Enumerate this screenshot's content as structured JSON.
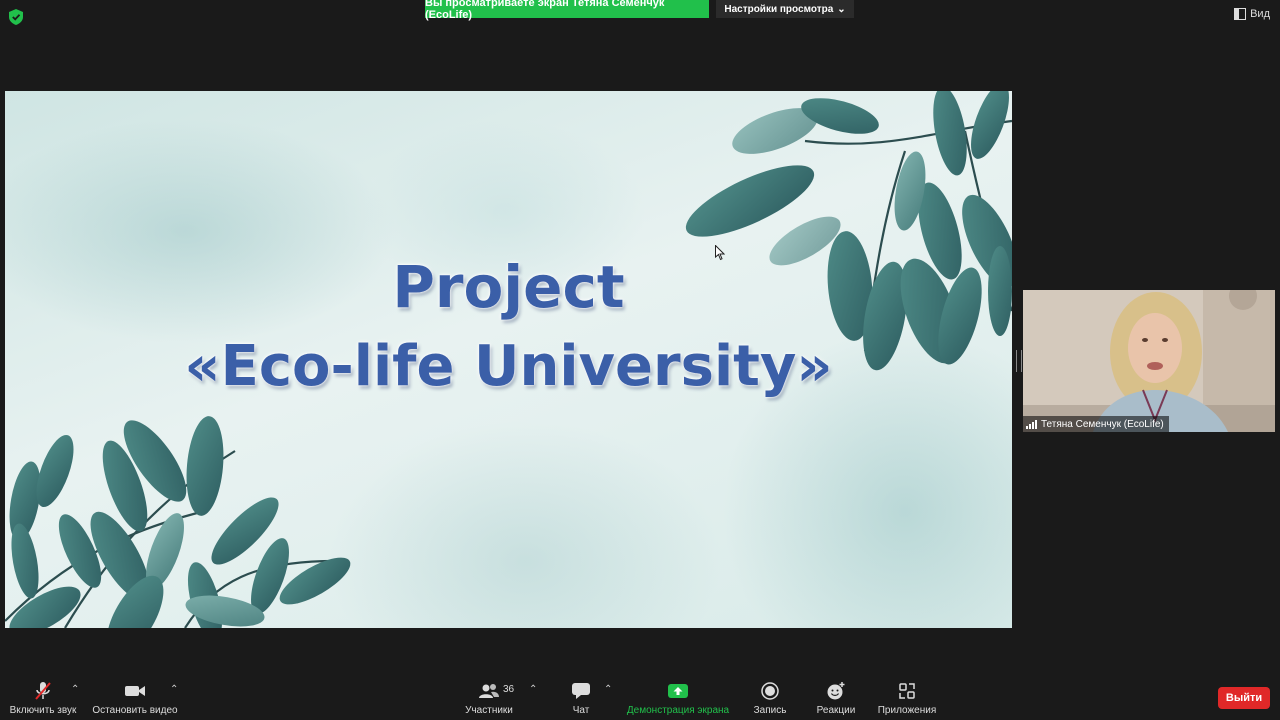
{
  "top_bar": {
    "share_banner": "Вы просматриваете экран Тетяна Семенчук (EcoLife)",
    "view_settings": "Настройки просмотра",
    "view_button": "Вид"
  },
  "slide": {
    "title_line1": "Project",
    "title_line2": "«Eco-life University»"
  },
  "video": {
    "participant_name": "Тетяна Семенчук (EcoLife)"
  },
  "toolbar": {
    "unmute": "Включить звук",
    "stop_video": "Остановить видео",
    "participants": "Участники",
    "participants_count": "36",
    "chat": "Чат",
    "share_screen": "Демонстрация экрана",
    "record": "Запись",
    "reactions": "Реакции",
    "apps": "Приложения",
    "leave": "Выйти"
  },
  "colors": {
    "share_green": "#21c04b",
    "leave_red": "#e02828",
    "title_blue": "#3b5fa8"
  }
}
